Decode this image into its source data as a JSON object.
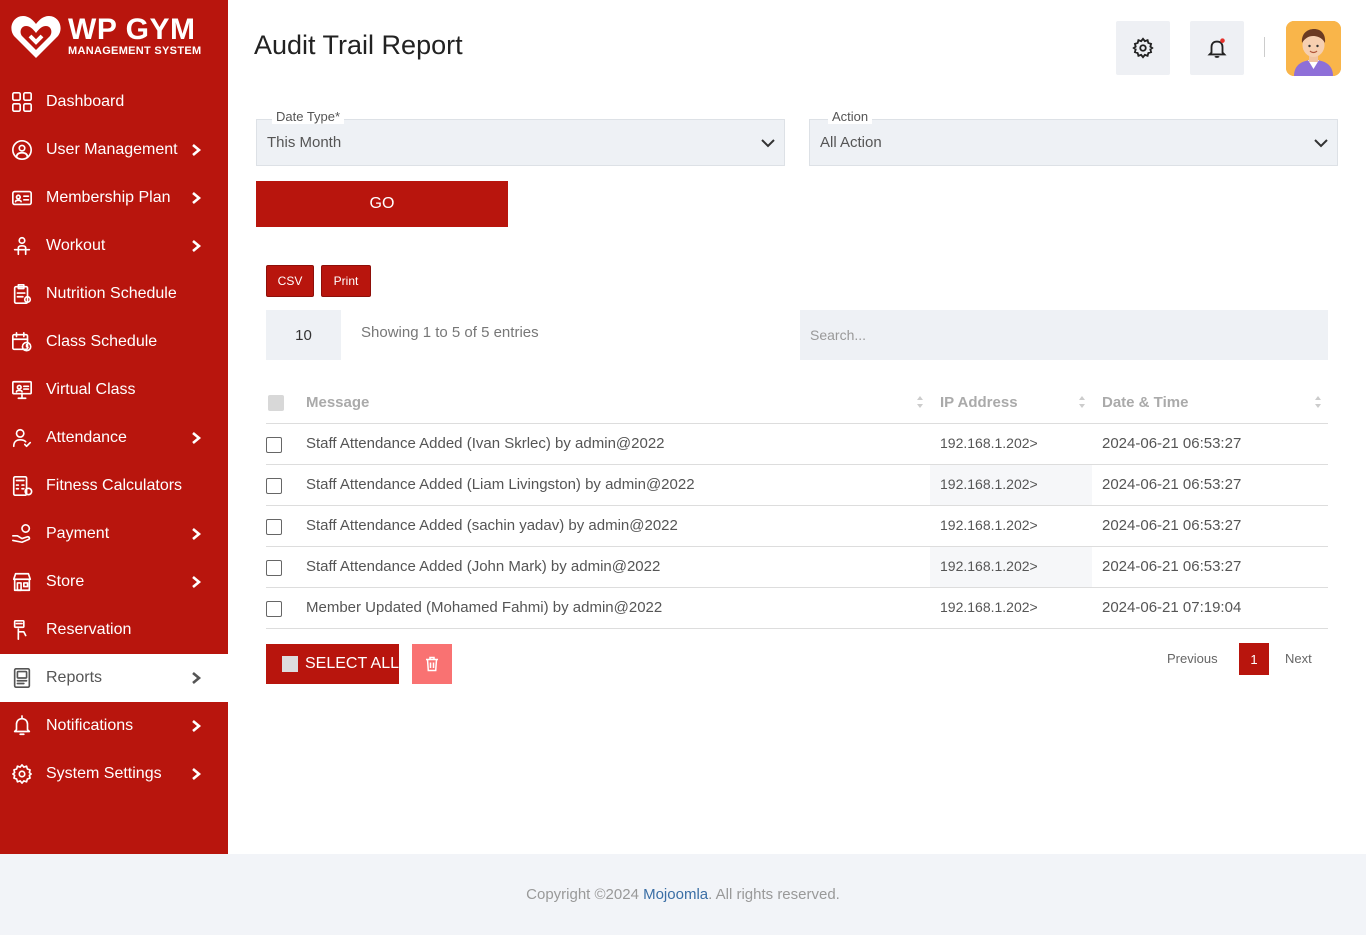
{
  "brand": {
    "title": "WP GYM",
    "subtitle": "MANAGEMENT SYSTEM"
  },
  "colors": {
    "primary": "#b8150d",
    "delete": "#f97272",
    "field_bg": "#eef1f5"
  },
  "sidebar": {
    "items": [
      {
        "label": "Dashboard",
        "icon": "dashboard-grid-icon",
        "has_submenu": false
      },
      {
        "label": "User Management",
        "icon": "users-gear-icon",
        "has_submenu": true
      },
      {
        "label": "Membership Plan",
        "icon": "id-card-icon",
        "has_submenu": true
      },
      {
        "label": "Workout",
        "icon": "dumbbell-user-icon",
        "has_submenu": true
      },
      {
        "label": "Nutrition Schedule",
        "icon": "clipboard-nutrition-icon",
        "has_submenu": false
      },
      {
        "label": "Class Schedule",
        "icon": "calendar-clock-icon",
        "has_submenu": false
      },
      {
        "label": "Virtual Class",
        "icon": "presentation-board-icon",
        "has_submenu": false
      },
      {
        "label": "Attendance",
        "icon": "user-check-icon",
        "has_submenu": true
      },
      {
        "label": "Fitness Calculators",
        "icon": "calculator-icon",
        "has_submenu": false
      },
      {
        "label": "Payment",
        "icon": "hand-coin-icon",
        "has_submenu": true
      },
      {
        "label": "Store",
        "icon": "store-icon",
        "has_submenu": true
      },
      {
        "label": "Reservation",
        "icon": "reservation-icon",
        "has_submenu": false
      },
      {
        "label": "Reports",
        "icon": "report-document-icon",
        "has_submenu": true,
        "active": true
      },
      {
        "label": "Notifications",
        "icon": "bell-icon",
        "has_submenu": true
      },
      {
        "label": "System Settings",
        "icon": "gear-icon",
        "has_submenu": true
      }
    ]
  },
  "header": {
    "title": "Audit Trail Report",
    "settings_icon": "gear-icon",
    "notification_icon": "bell-icon"
  },
  "filters": {
    "date_type_label": "Date Type*",
    "date_type_value": "This Month",
    "action_label": "Action",
    "action_value": "All Action",
    "go_label": "GO"
  },
  "export": {
    "csv_label": "CSV",
    "print_label": "Print"
  },
  "table_controls": {
    "page_length": "10",
    "info": "Showing 1 to 5 of 5 entries",
    "search_placeholder": "Search..."
  },
  "table": {
    "columns": [
      "Message",
      "IP Address",
      "Date & Time"
    ],
    "rows": [
      {
        "message": "Staff Attendance Added (Ivan Skrlec) by admin@2022",
        "ip": "192.168.1.202>",
        "datetime": "2024-06-21 06:53:27"
      },
      {
        "message": "Staff Attendance Added (Liam Livingston) by admin@2022",
        "ip": "192.168.1.202>",
        "datetime": "2024-06-21 06:53:27"
      },
      {
        "message": "Staff Attendance Added (sachin yadav) by admin@2022",
        "ip": "192.168.1.202>",
        "datetime": "2024-06-21 06:53:27"
      },
      {
        "message": "Staff Attendance Added (John Mark) by admin@2022",
        "ip": "192.168.1.202>",
        "datetime": "2024-06-21 06:53:27"
      },
      {
        "message": "Member Updated (Mohamed Fahmi) by admin@2022",
        "ip": "192.168.1.202>",
        "datetime": "2024-06-21 07:19:04"
      }
    ]
  },
  "bulk": {
    "select_all_label": "SELECT ALL",
    "delete_icon": "trash-icon"
  },
  "pagination": {
    "previous": "Previous",
    "current": "1",
    "next": "Next"
  },
  "footer": {
    "prefix": "Copyright ©2024 ",
    "brand": "Mojoomla",
    "suffix": ". All rights reserved."
  }
}
